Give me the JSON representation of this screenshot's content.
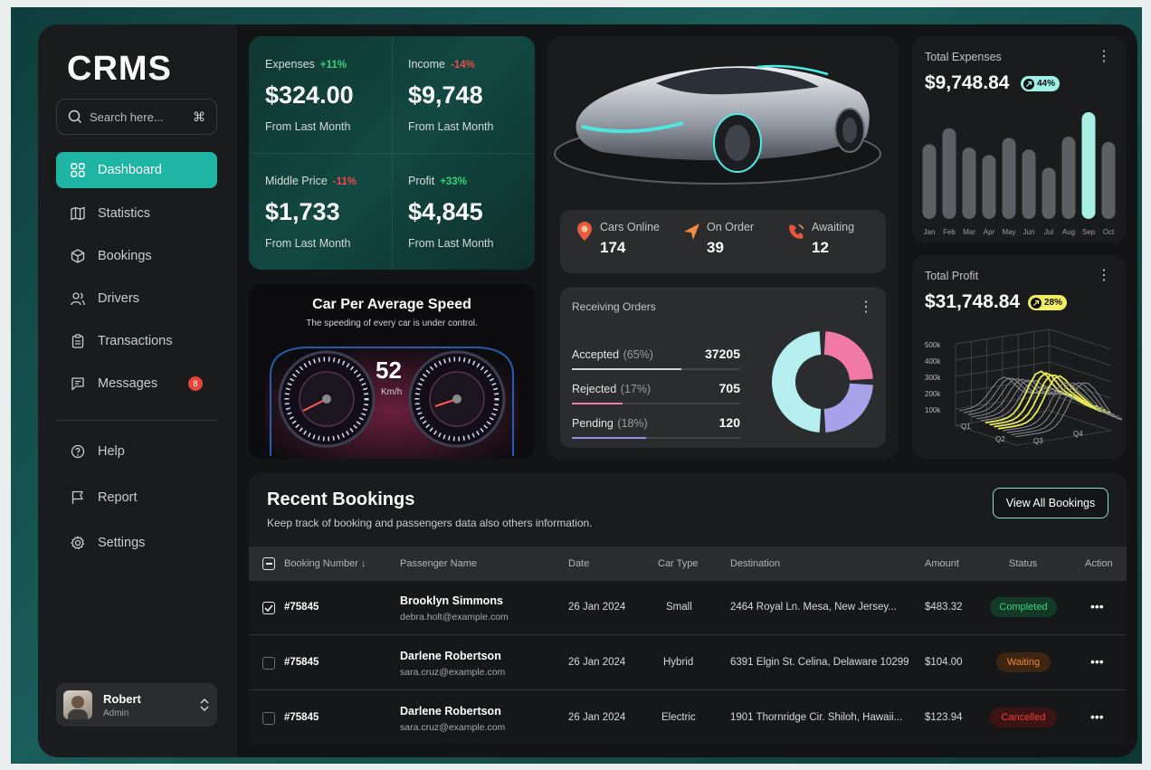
{
  "app": {
    "logo": "CRMS"
  },
  "search": {
    "placeholder": "Search here...",
    "shortcut": "⌘"
  },
  "sidebar": {
    "items": [
      {
        "label": "Dashboard",
        "icon": "grid-icon",
        "active": true
      },
      {
        "label": "Statistics",
        "icon": "map-icon"
      },
      {
        "label": "Bookings",
        "icon": "box-icon"
      },
      {
        "label": "Drivers",
        "icon": "users-icon"
      },
      {
        "label": "Transactions",
        "icon": "clipboard-icon"
      },
      {
        "label": "Messages",
        "icon": "message-icon",
        "badge": "8"
      }
    ],
    "secondary": [
      {
        "label": "Help",
        "icon": "help-icon"
      },
      {
        "label": "Report",
        "icon": "flag-icon"
      },
      {
        "label": "Settings",
        "icon": "gear-icon"
      }
    ]
  },
  "user": {
    "name": "Robert",
    "role": "Admin"
  },
  "kpis": [
    {
      "label": "Expenses",
      "change": "+11%",
      "trend": "up",
      "value": "$324.00",
      "sub": "From Last Month"
    },
    {
      "label": "Income",
      "change": "-14%",
      "trend": "down",
      "value": "$9,748",
      "sub": "From Last Month"
    },
    {
      "label": "Middle Price",
      "change": "-11%",
      "trend": "down",
      "value": "$1,733",
      "sub": "From Last Month"
    },
    {
      "label": "Profit",
      "change": "+33%",
      "trend": "up",
      "value": "$4,845",
      "sub": "From Last Month"
    }
  ],
  "speed": {
    "title": "Car Per Average Speed",
    "subtitle": "The speeding of every car is under control.",
    "value": "52",
    "unit": "Km/h"
  },
  "fleet": {
    "cars_online": {
      "label": "Cars Online",
      "value": "174"
    },
    "on_order": {
      "label": "On Order",
      "value": "39"
    },
    "awaiting": {
      "label": "Awaiting",
      "value": "12"
    }
  },
  "orders": {
    "title": "Receiving Orders",
    "rows": [
      {
        "label": "Accepted",
        "pct": "(65%)",
        "value": "37205",
        "fraction": 0.65,
        "color": "#cfd3d4"
      },
      {
        "label": "Rejected",
        "pct": "(17%)",
        "value": "705",
        "fraction": 0.3,
        "color": "#f07aa3"
      },
      {
        "label": "Pending",
        "pct": "(18%)",
        "value": "120",
        "fraction": 0.44,
        "color": "#8f8ee0"
      }
    ],
    "donut": [
      {
        "name": "Accepted",
        "fraction": 0.5,
        "color": "#b6eef0"
      },
      {
        "name": "Rejected",
        "fraction": 0.25,
        "color": "#f07aa3"
      },
      {
        "name": "Pending",
        "fraction": 0.25,
        "color": "#a6a3ea"
      }
    ]
  },
  "total_expenses": {
    "title": "Total Expenses",
    "value": "$9,748.84",
    "badge": "44%",
    "badge_color": "#9ff0e6"
  },
  "total_profit": {
    "title": "Total Profit",
    "value": "$31,748.84",
    "badge": "28%",
    "badge_color": "#f2ee62"
  },
  "chart_data": [
    {
      "type": "bar",
      "categories": [
        "Jan",
        "Feb",
        "Mar",
        "Apr",
        "May",
        "Jun",
        "Jul",
        "Aug",
        "Sep",
        "Oct"
      ],
      "values": [
        70,
        85,
        67,
        60,
        76,
        65,
        48,
        77,
        100,
        72
      ],
      "highlight_index": 8,
      "bar_color": "#5c5f63",
      "highlight_color": "#a8f0e4",
      "grid": false
    },
    {
      "type": "area",
      "subtype": "3d-surface",
      "y_ticks": [
        "500k",
        "400k",
        "300k",
        "200k",
        "100k"
      ],
      "x_ticks": [
        "Q1",
        "Q2",
        "Q3",
        "Q4"
      ],
      "highlight_color": "#e9ea53",
      "line_color": "#8b8e91"
    }
  ],
  "bookings": {
    "title": "Recent Bookings",
    "description": "Keep track of booking and passengers data also others information.",
    "view_all": "View All Bookings",
    "columns": [
      "Booking Number",
      "Passenger Name",
      "Date",
      "Car Type",
      "Destination",
      "Amount",
      "Status",
      "Action"
    ],
    "rows": [
      {
        "checked": true,
        "number": "#75845",
        "name": "Brooklyn Simmons",
        "email": "debra.holt@example.com",
        "date": "26 Jan 2024",
        "car": "Small",
        "destination": "2464 Royal Ln. Mesa, New Jersey...",
        "amount": "$483.32",
        "status": "Completed",
        "action": "•••"
      },
      {
        "checked": false,
        "number": "#75845",
        "name": "Darlene Robertson",
        "email": "sara.cruz@example.com",
        "date": "26 Jan 2024",
        "car": "Hybrid",
        "destination": "6391 Elgin St. Celina, Delaware 10299",
        "amount": "$104.00",
        "status": "Waiting",
        "action": "•••"
      },
      {
        "checked": false,
        "number": "#75845",
        "name": "Darlene Robertson",
        "email": "sara.cruz@example.com",
        "date": "26 Jan 2024",
        "car": "Electric",
        "destination": "1901 Thornridge Cir. Shiloh, Hawaii...",
        "amount": "$123.94",
        "status": "Cancelled",
        "action": "•••"
      }
    ]
  }
}
